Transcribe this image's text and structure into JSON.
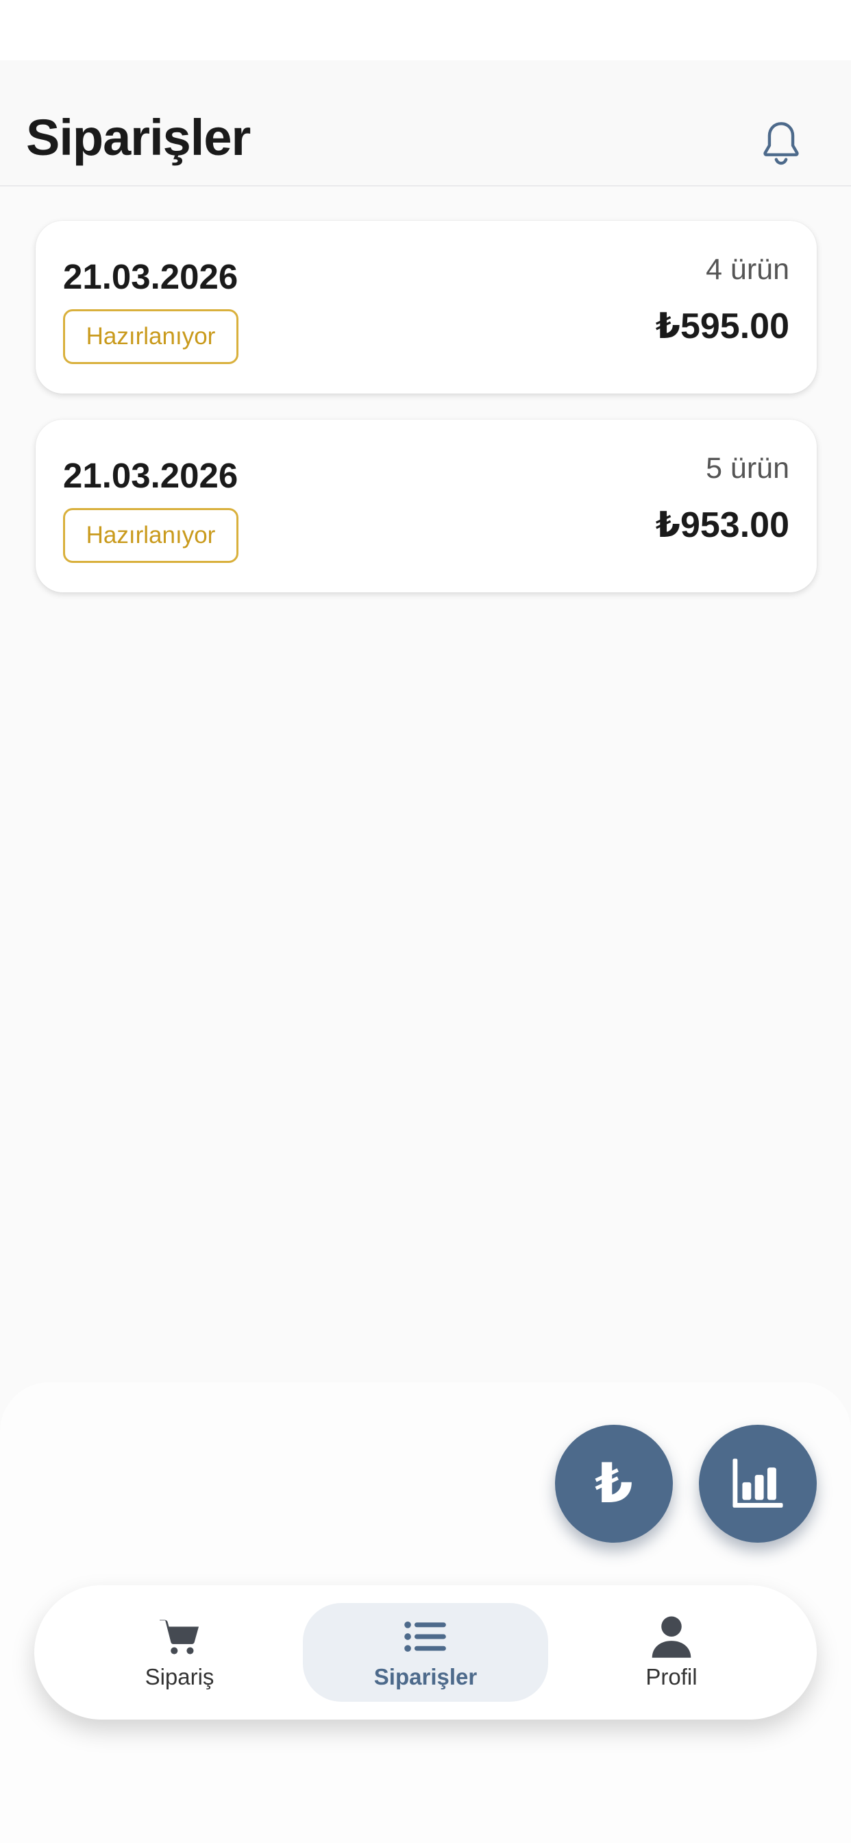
{
  "header": {
    "title": "Siparişler",
    "notification_icon": "bell-icon"
  },
  "orders": [
    {
      "date": "21.03.2026",
      "status": "Hazırlanıyor",
      "item_count": "4 ürün",
      "total": "₺595.00"
    },
    {
      "date": "21.03.2026",
      "status": "Hazırlanıyor",
      "item_count": "5 ürün",
      "total": "₺953.00"
    }
  ],
  "fabs": {
    "currency": {
      "icon": "lira-icon",
      "glyph": "₺"
    },
    "stats": {
      "icon": "bar-chart-icon"
    }
  },
  "bottom_nav": {
    "items": [
      {
        "label": "Sipariş",
        "icon": "cart-icon",
        "active": false
      },
      {
        "label": "Siparişler",
        "icon": "list-icon",
        "active": true
      },
      {
        "label": "Profil",
        "icon": "person-icon",
        "active": false
      }
    ]
  },
  "colors": {
    "accent": "#4d6a8b",
    "status_pending": "#d9b03c",
    "background": "#fafafa",
    "nav_active_bg": "#ebeff4"
  }
}
